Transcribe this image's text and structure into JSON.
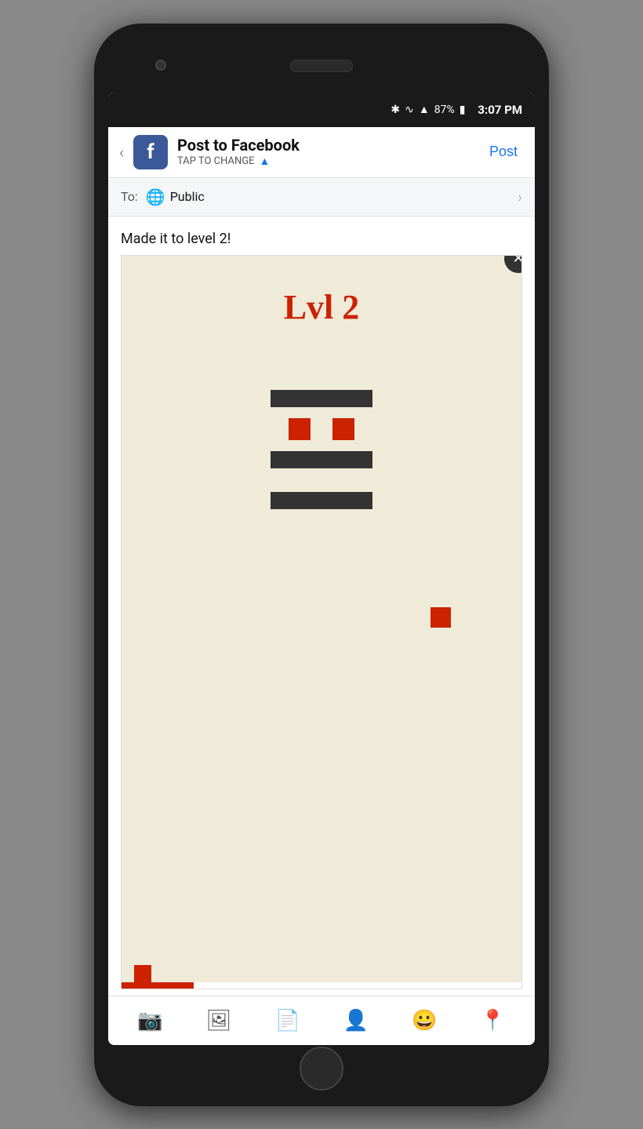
{
  "status_bar": {
    "time": "3:07 PM",
    "battery_percent": "87%",
    "icons": [
      "bluetooth",
      "wifi",
      "signal",
      "battery"
    ]
  },
  "header": {
    "back_label": "‹",
    "fb_letter": "f",
    "title": "Post to Facebook",
    "subtitle": "TAP TO CHANGE",
    "post_button": "Post"
  },
  "audience": {
    "label": "To:",
    "globe_icon": "🌐",
    "audience_text": "Public",
    "chevron": "›"
  },
  "compose": {
    "post_text": "Made it to level 2!"
  },
  "game_image": {
    "level_text": "Lvl 2",
    "close_icon": "✕"
  },
  "toolbar": {
    "icons": [
      "camera",
      "image",
      "article",
      "person-add",
      "emoji",
      "location"
    ]
  }
}
